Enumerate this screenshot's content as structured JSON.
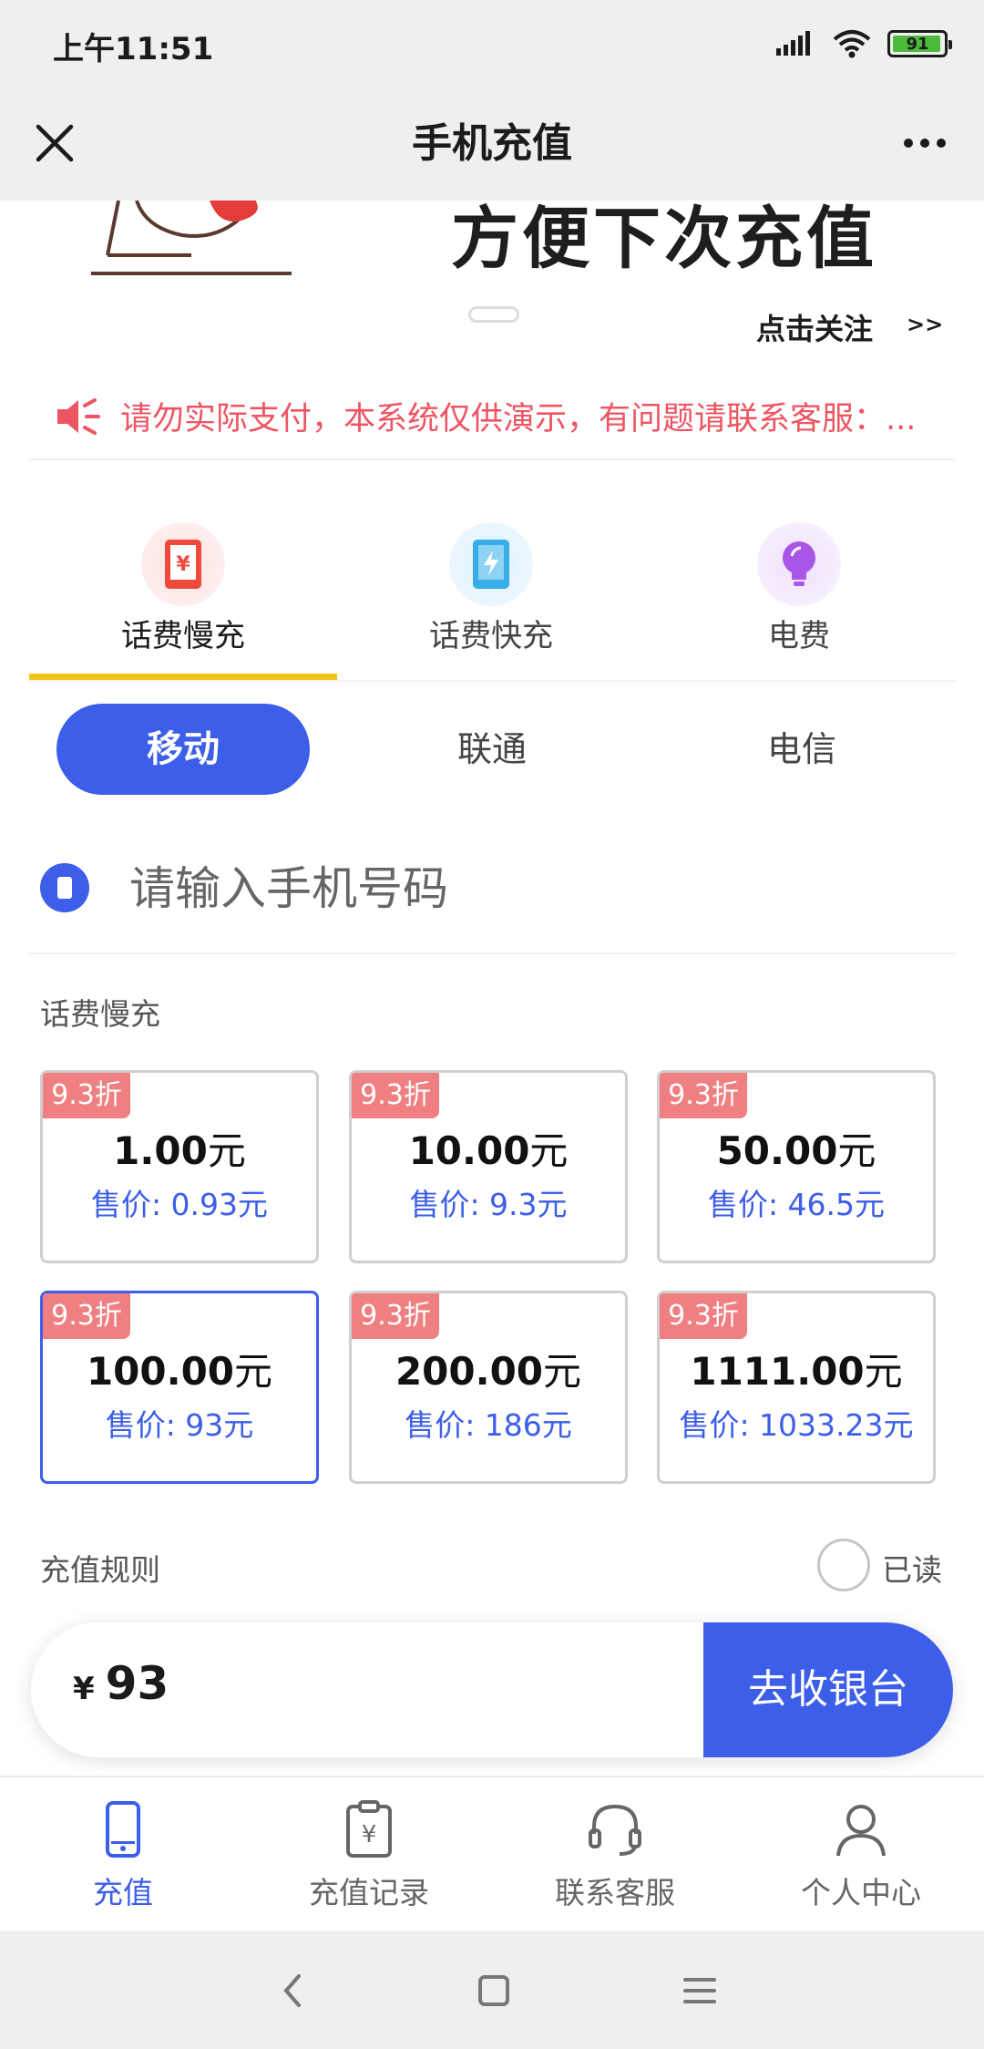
{
  "status_bar": {
    "time": "上午11:51",
    "battery": "91"
  },
  "nav": {
    "title": "手机充值"
  },
  "banner": {
    "text": "方便下次充值",
    "follow": "点击关注",
    "follow_arrow": ">>"
  },
  "notice": {
    "text": "请勿实际支付，本系统仅供演示，有问题请联系客服：..."
  },
  "categories": [
    {
      "label": "话费慢充",
      "icon": "phone-yuan-icon",
      "active": true
    },
    {
      "label": "话费快充",
      "icon": "phone-lightning-icon",
      "active": false
    },
    {
      "label": "电费",
      "icon": "lightbulb-icon",
      "active": false
    }
  ],
  "carriers": [
    {
      "label": "移动",
      "active": true
    },
    {
      "label": "联通",
      "active": false
    },
    {
      "label": "电信",
      "active": false
    }
  ],
  "phone": {
    "placeholder": "请输入手机号码"
  },
  "section_title": "话费慢充",
  "packages": [
    {
      "tag": "9.3折",
      "face_value": "1.00",
      "unit": "元",
      "price": "售价: 0.93元"
    },
    {
      "tag": "9.3折",
      "face_value": "10.00",
      "unit": "元",
      "price": "售价: 9.3元"
    },
    {
      "tag": "9.3折",
      "face_value": "50.00",
      "unit": "元",
      "price": "售价: 46.5元"
    },
    {
      "tag": "9.3折",
      "face_value": "100.00",
      "unit": "元",
      "price": "售价: 93元",
      "selected": true
    },
    {
      "tag": "9.3折",
      "face_value": "200.00",
      "unit": "元",
      "price": "售价: 186元"
    },
    {
      "tag": "9.3折",
      "face_value": "1111.00",
      "unit": "元",
      "price": "售价: 1033.23元"
    }
  ],
  "rules": {
    "label": "充值规则",
    "read_label": "已读",
    "read_checked": false
  },
  "pay": {
    "currency": "¥",
    "amount": "93",
    "button": "去收银台"
  },
  "tabs": [
    {
      "label": "充值",
      "icon": "phone-icon",
      "active": true
    },
    {
      "label": "充值记录",
      "icon": "clipboard-yuan-icon",
      "active": false
    },
    {
      "label": "联系客服",
      "icon": "headset-icon",
      "active": false
    },
    {
      "label": "个人中心",
      "icon": "user-icon",
      "active": false
    }
  ],
  "colors": {
    "primary": "#3c5ee9",
    "tag": "#f07f82",
    "accent_underline": "#f2c418",
    "notice": "#ee5563"
  }
}
